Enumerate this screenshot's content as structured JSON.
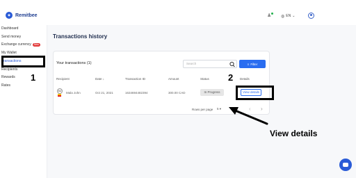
{
  "brand": {
    "name": "Remitbee"
  },
  "header": {
    "language": "EN"
  },
  "sidebar": {
    "items": [
      {
        "label": "Dashboard"
      },
      {
        "label": "Send money"
      },
      {
        "label": "Exchange currency",
        "badge": "New"
      },
      {
        "label": "My Wallet"
      },
      {
        "label": "Transactions"
      },
      {
        "label": "Recipients"
      },
      {
        "label": "Rewards"
      },
      {
        "label": "Rates"
      }
    ]
  },
  "main": {
    "title": "Transactions history",
    "card": {
      "title": "Your transactions (1)",
      "search_placeholder": "Search",
      "filter_label": "Filter",
      "columns": [
        "Recipient",
        "Date ↓",
        "Transaction ID",
        "Amount",
        "Status",
        "Details"
      ],
      "row": {
        "avatar": "MJ",
        "recipient": "Mala John",
        "date": "Oct 21, 2021",
        "transaction_id": "1634694482394",
        "amount": "300.00 CAD",
        "status": "In Progress",
        "details_button": "View details"
      },
      "rows_per_page_label": "Rows per page",
      "rows_per_page_value": "5"
    }
  },
  "annotations": {
    "step1": "1",
    "step2": "2",
    "arrow_label": "View details"
  },
  "colors": {
    "accent": "#2a6df0",
    "brand": "#1f3e91"
  }
}
